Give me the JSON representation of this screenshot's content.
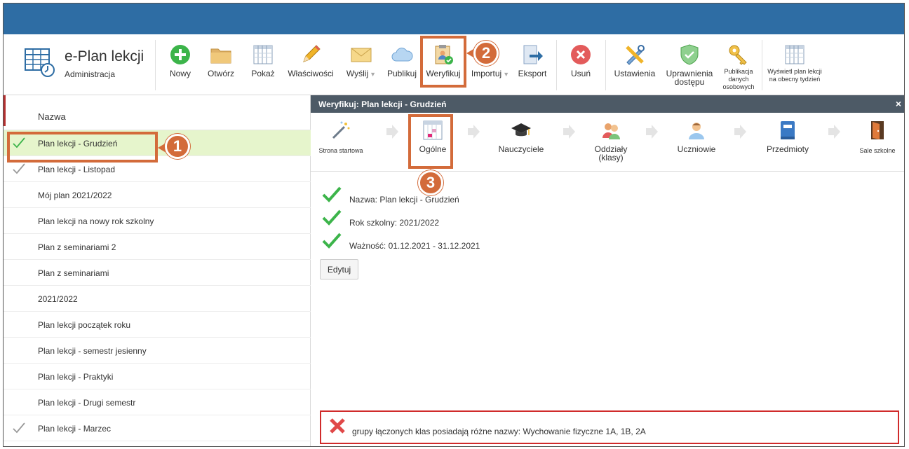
{
  "app": {
    "title": "e-Plan lekcji",
    "subtitle": "Administracja"
  },
  "toolbar": {
    "new": "Nowy",
    "open": "Otwórz",
    "show": "Pokaż",
    "properties": "Właściwości",
    "send": "Wyślij",
    "publish": "Publikuj",
    "verify": "Weryfikuj",
    "import": "Importuj",
    "export": "Eksport",
    "delete": "Usuń",
    "settings": "Ustawienia",
    "permissions": "Uprawnienia dostępu",
    "publication": "Publikacja danych osobowych",
    "show_week": "Wyświetl plan lekcji na obecny tydzień",
    "dropdown_glyph": "▼"
  },
  "list": {
    "header": "Nazwa",
    "items": [
      {
        "label": "Plan lekcji - Grudzień",
        "check": "green",
        "selected": true
      },
      {
        "label": "Plan lekcji - Listopad",
        "check": "gray",
        "selected": false
      },
      {
        "label": "Mój plan 2021/2022",
        "check": "",
        "selected": false
      },
      {
        "label": "Plan lekcji na nowy rok szkolny",
        "check": "",
        "selected": false
      },
      {
        "label": "Plan z seminariami 2",
        "check": "",
        "selected": false
      },
      {
        "label": "Plan z seminariami",
        "check": "",
        "selected": false
      },
      {
        "label": "2021/2022",
        "check": "",
        "selected": false
      },
      {
        "label": "Plan lekcji początek roku",
        "check": "",
        "selected": false
      },
      {
        "label": "Plan lekcji - semestr jesienny",
        "check": "",
        "selected": false
      },
      {
        "label": "Plan lekcji - Praktyki",
        "check": "",
        "selected": false
      },
      {
        "label": "Plan lekcji - Drugi semestr",
        "check": "",
        "selected": false
      },
      {
        "label": "Plan lekcji - Marzec",
        "check": "gray",
        "selected": false
      }
    ]
  },
  "dialog": {
    "title": "Weryfikuj: Plan lekcji - Grudzień",
    "close": "×",
    "steps": {
      "start": "Strona startowa",
      "general": "Ogólne",
      "teachers": "Nauczyciele",
      "classes": "Oddziały (klasy)",
      "students": "Uczniowie",
      "subjects": "Przedmioty",
      "rooms": "Sale szkolne"
    },
    "checks": [
      "Nazwa: Plan lekcji - Grudzień",
      "Rok szkolny: 2021/2022",
      "Ważność: 01.12.2021 - 31.12.2021"
    ],
    "edit": "Edytuj",
    "error": "grupy łączonych klas posiadają różne nazwy: Wychowanie fizyczne 1A, 1B, 2A"
  },
  "annotations": {
    "one": "1",
    "two": "2",
    "three": "3"
  },
  "colors": {
    "accent_blue": "#2e6da4",
    "highlight": "#d36b3a",
    "selected_row": "#e6f5cc",
    "error": "#d02b2b"
  }
}
